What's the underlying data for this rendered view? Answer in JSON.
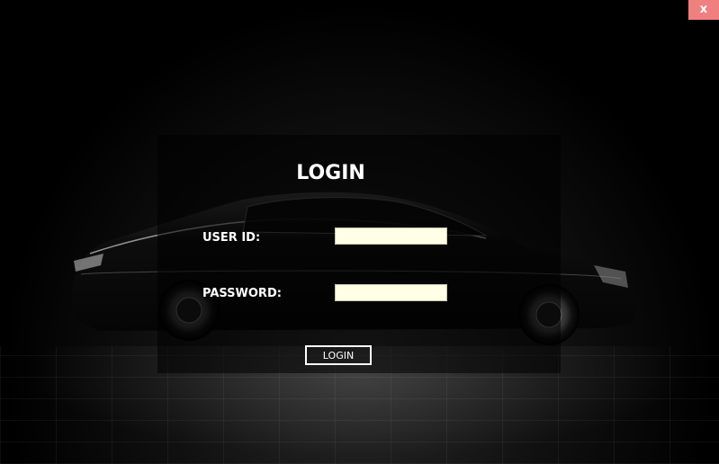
{
  "window": {
    "close_label": "x"
  },
  "form": {
    "title": "LOGIN",
    "user_id_label": "USER ID:",
    "user_id_value": "",
    "password_label": "PASSWORD:",
    "password_value": "",
    "login_button_label": "LOGIN"
  },
  "colors": {
    "close_button": "#f08080",
    "field_background": "#ffffe6",
    "background": "#000000",
    "text": "#ffffff"
  }
}
